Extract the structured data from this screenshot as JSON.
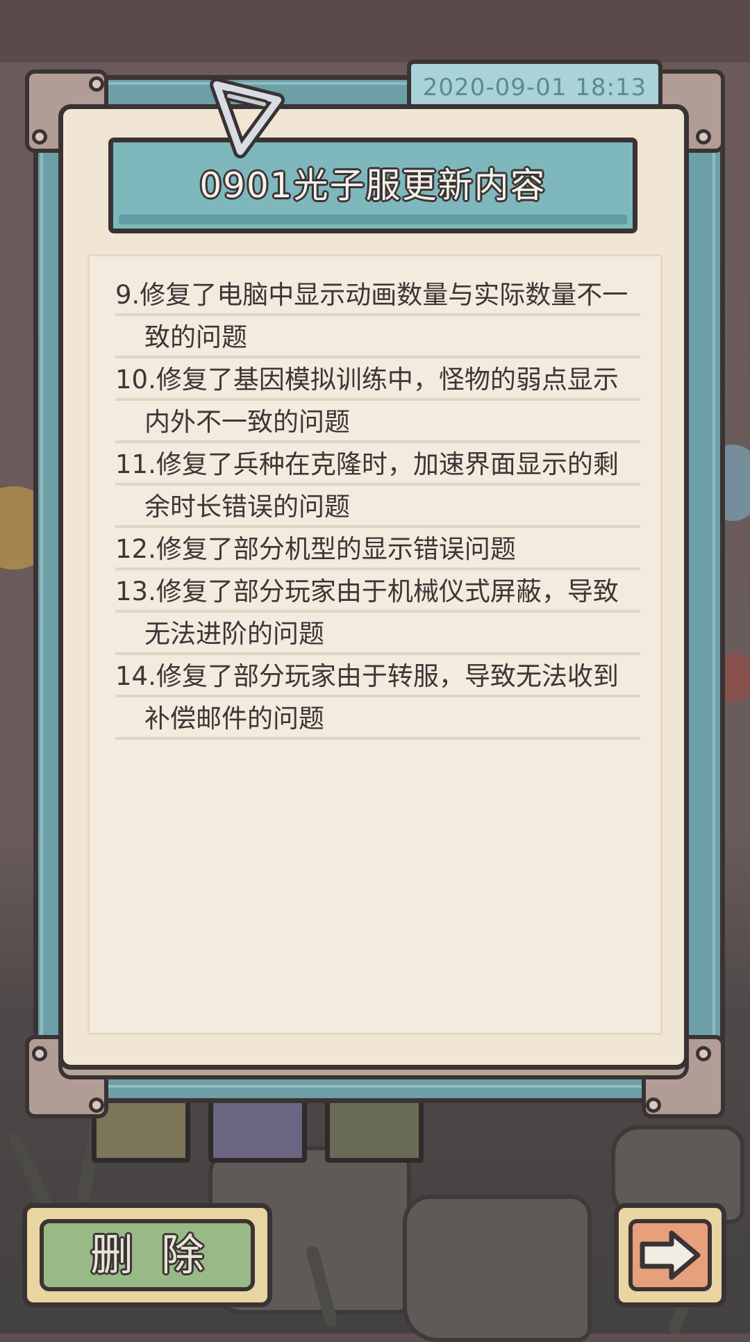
{
  "notice": {
    "timestamp": "2020-09-01  18:13",
    "title": "0901光子服更新内容",
    "lines": [
      {
        "text": "9.修复了电脑中显示动画数量与实际数量不一",
        "continued": false
      },
      {
        "text": "致的问题",
        "continued": true
      },
      {
        "text": "10.修复了基因模拟训练中，怪物的弱点显示",
        "continued": false
      },
      {
        "text": "内外不一致的问题",
        "continued": true
      },
      {
        "text": "11.修复了兵种在克隆时，加速界面显示的剩",
        "continued": false
      },
      {
        "text": "余时长错误的问题",
        "continued": true
      },
      {
        "text": "12.修复了部分机型的显示错误问题",
        "continued": false
      },
      {
        "text": "13.修复了部分玩家由于机械仪式屏蔽，导致",
        "continued": false
      },
      {
        "text": "无法进阶的问题",
        "continued": true
      },
      {
        "text": "14.修复了部分玩家由于转服，导致无法收到",
        "continued": false
      },
      {
        "text": "补偿邮件的问题",
        "continued": true
      }
    ]
  },
  "buttons": {
    "delete_label": "删除",
    "next_icon": "right-arrow-icon"
  },
  "colors": {
    "frame": "#6d9fa7",
    "paper": "#f0e6d3",
    "banner": "#7eb8bd",
    "delete_button": "#99b987",
    "next_button": "#e6a17c",
    "outline": "#3a3334"
  }
}
